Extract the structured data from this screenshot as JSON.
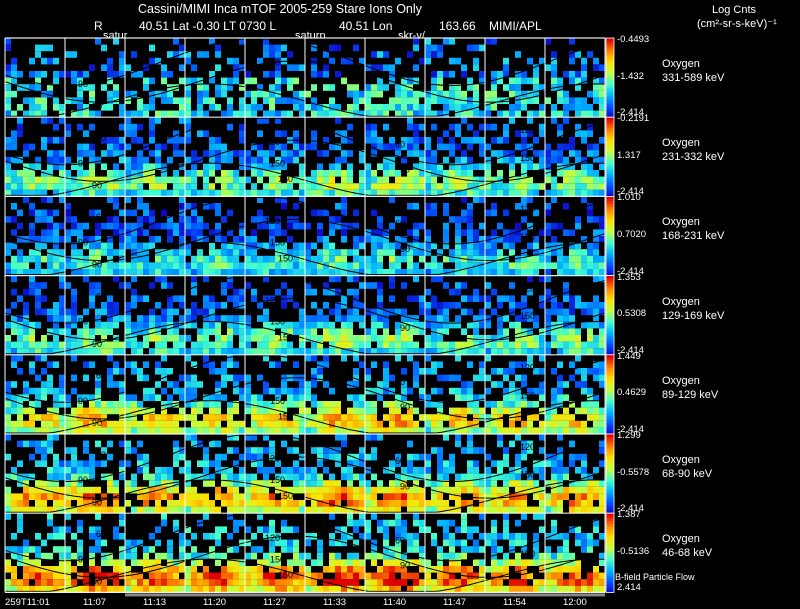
{
  "header": {
    "title": "Cassini/MIMI Inca mTOF  2005-259   Stare   Ions Only",
    "r_label": "R",
    "lat_text": "40.51 Lat -0.30 LT 0730 L",
    "lon_text": "40.51 Lon",
    "lon_value": "163.66",
    "institution": "MIMI/APL",
    "units_title": "Log Cnts",
    "units": "(cm²-sr-s-keV)⁻¹"
  },
  "plot_tags": [
    "satur",
    "saturn",
    "skr-v/"
  ],
  "footer": {
    "legend": "B-field Particle Flow"
  },
  "chart_data": {
    "type": "heatmap",
    "x_ticks": [
      "259T11:01",
      "11:07",
      "11:13",
      "11:20",
      "11:27",
      "11:33",
      "11:40",
      "11:47",
      "11:54",
      "12:00"
    ],
    "contour_labels": [
      "15",
      "30",
      "60",
      "90",
      "120",
      "150"
    ],
    "colorscale": [
      "#1000c0",
      "#0050ff",
      "#00b0ff",
      "#40ffd0",
      "#c0ff40",
      "#ffe000",
      "#ff8000",
      "#e00000"
    ],
    "panels": [
      {
        "species": "Oxygen",
        "energy": "331-589 keV",
        "cbar_max": "-0.4493",
        "cbar_mid": "-1.432",
        "cbar_min": "-2.414"
      },
      {
        "species": "Oxygen",
        "energy": "231-332 keV",
        "cbar_max": "-0.2191",
        "cbar_mid": "1.317",
        "cbar_min": "-2.414"
      },
      {
        "species": "Oxygen",
        "energy": "168-231 keV",
        "cbar_max": "1.010",
        "cbar_mid": "0.7020",
        "cbar_min": "-2.414"
      },
      {
        "species": "Oxygen",
        "energy": "129-169 keV",
        "cbar_max": "1.353",
        "cbar_mid": "0.5308",
        "cbar_min": "-2.414"
      },
      {
        "species": "Oxygen",
        "energy": "89-129 keV",
        "cbar_max": "1.449",
        "cbar_mid": "0.4629",
        "cbar_min": "-2.414"
      },
      {
        "species": "Oxygen",
        "energy": "68-90 keV",
        "cbar_max": "1.299",
        "cbar_mid": "-0.5578",
        "cbar_min": "-2.414"
      },
      {
        "species": "Oxygen",
        "energy": "46-68 keV",
        "cbar_max": "1.387",
        "cbar_mid": "-0.5136",
        "cbar_min": "2.414"
      }
    ]
  }
}
